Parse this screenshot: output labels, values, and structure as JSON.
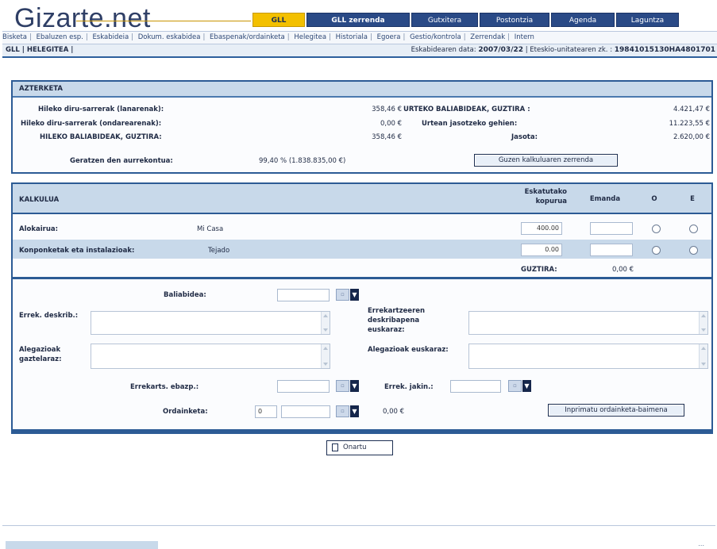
{
  "logo": {
    "text": "Gizarte.net"
  },
  "topnav": [
    {
      "label": "GLL",
      "active": true
    },
    {
      "label": "GLL zerrenda",
      "active": false,
      "bold": true
    },
    {
      "label": "Gutxitera",
      "active": false
    },
    {
      "label": "Postontzia",
      "active": false
    },
    {
      "label": "Agenda",
      "active": false
    },
    {
      "label": "Laguntza",
      "active": false
    }
  ],
  "subnav": [
    "Bisketa",
    "Ebaluzen esp.",
    "Eskabideia",
    "Dokum. eskabidea",
    "Ebaspenak/ordainketa",
    "Helegitea",
    "Historiala",
    "Egoera",
    "Gestio/kontrola",
    "Zerrendak",
    "Intern"
  ],
  "crumb": {
    "left": "GLL | HELEGITEA |",
    "date_label": "Eskabidearen data:",
    "date_value": "2007/03/22",
    "id_label": "| Eteskio-unitatearen zk. :",
    "id_value": "19841015130HA4801701"
  },
  "aztertzea": {
    "title": "AZTERKETA",
    "rows": [
      {
        "label": "Hileko diru-sarrerak (lanarenak):",
        "value": "358,46 €"
      },
      {
        "label": "Hileko diru-sarrerak (ondarearenak):",
        "value": "0,00 €"
      },
      {
        "label": "HILEKO BALIABIDEAK, GUZTIRA:",
        "value": "358,46 €"
      },
      {
        "label": "Geratzen den aurrekontua:",
        "value": "99,40 % (1.838.835,00 €)"
      }
    ],
    "right_rows": [
      {
        "label": "URTEKO BALIABIDEAK, GUZTIRA :",
        "value": "4.421,47 €"
      },
      {
        "label": "Urtean jasotzeko gehien:",
        "value": "11.223,55 €"
      },
      {
        "label": "Jasota:",
        "value": "2.620,00 €"
      }
    ],
    "button": "Guzen kalkuluaren zerrenda"
  },
  "kalkulua": {
    "title": "KALKULUA",
    "headers": {
      "eskatutako": "Eskatutako kopurua",
      "emanda": "Emanda",
      "o": "O",
      "e": "E"
    },
    "rows": [
      {
        "label": "Alokairua:",
        "desc": "Mi Casa",
        "amount": "400.00",
        "given": ""
      },
      {
        "label": "Konponketak eta instalazioak:",
        "desc": "Tejado",
        "amount": "0.00",
        "given": ""
      }
    ],
    "total_label": "GUZTIRA:",
    "total_value": "0,00 €"
  },
  "form": {
    "baliabidea_label": "Baliabidea:",
    "errek_deskrib_label": "Errek. deskrib.:",
    "errek_deskribapena_label": "Errekartzeeren deskribapena euskaraz:",
    "alegazioak_gazt_label": "Alegazioak gaztelaraz:",
    "alegazioak_eusk_label": "Alegazioak euskaraz:",
    "errekarts_ebazp_label": "Errekarts. ebazp.:",
    "errek_jakin_label": "Errek. jakin.:",
    "ordainketa_label": "Ordainketa:",
    "ordainketa_prefix": "0",
    "ordainketa_value": "0,00 €",
    "print_button": "Inprimatu ordainketa-baimena"
  },
  "save_button": "Onartu",
  "bottom_right": "..."
}
